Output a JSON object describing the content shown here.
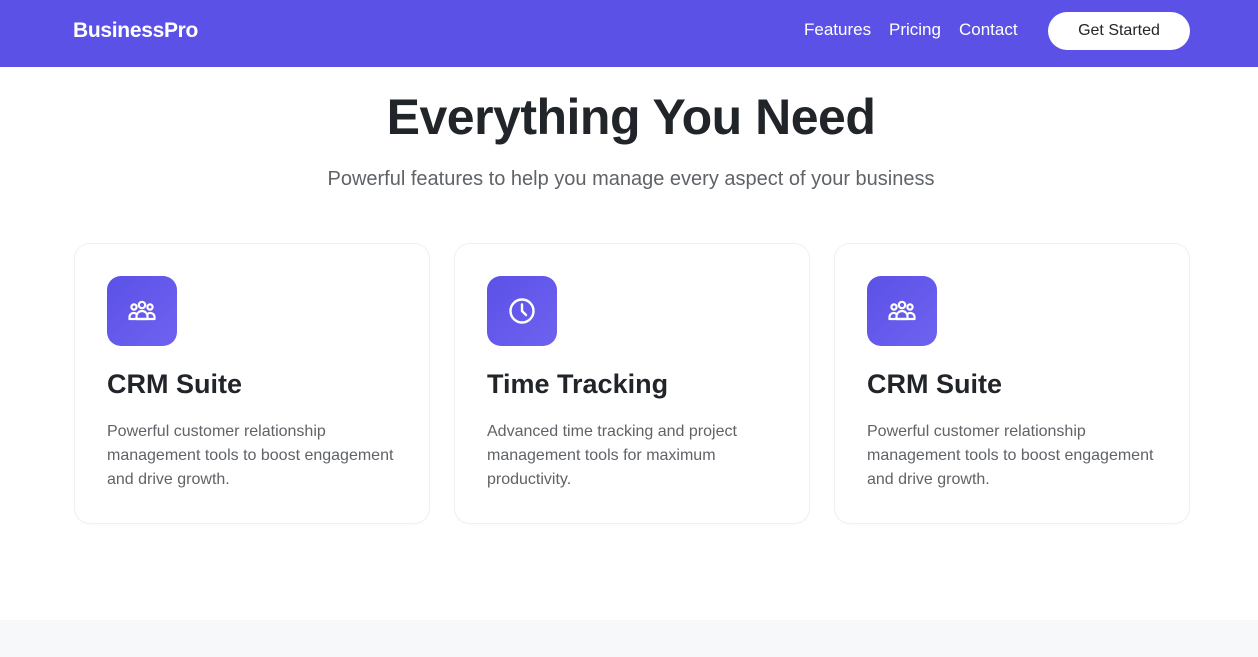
{
  "nav": {
    "brand": "BusinessPro",
    "links": [
      "Features",
      "Pricing",
      "Contact"
    ],
    "cta_label": "Get Started"
  },
  "hero": {
    "title": "Everything You Need",
    "subtitle": "Powerful features to help you manage every aspect of your business"
  },
  "cards": [
    {
      "icon": "users-icon",
      "title": "CRM Suite",
      "description": "Powerful customer relationship management tools to boost engagement and drive growth."
    },
    {
      "icon": "clock-icon",
      "title": "Time Tracking",
      "description": "Advanced time tracking and project management tools for maximum productivity."
    },
    {
      "icon": "users-icon",
      "title": "CRM Suite",
      "description": "Powerful customer relationship management tools to boost engagement and drive growth."
    }
  ],
  "colors": {
    "brand": "#5b51e6",
    "text_dark": "#212529",
    "text_muted": "#5f6368"
  }
}
